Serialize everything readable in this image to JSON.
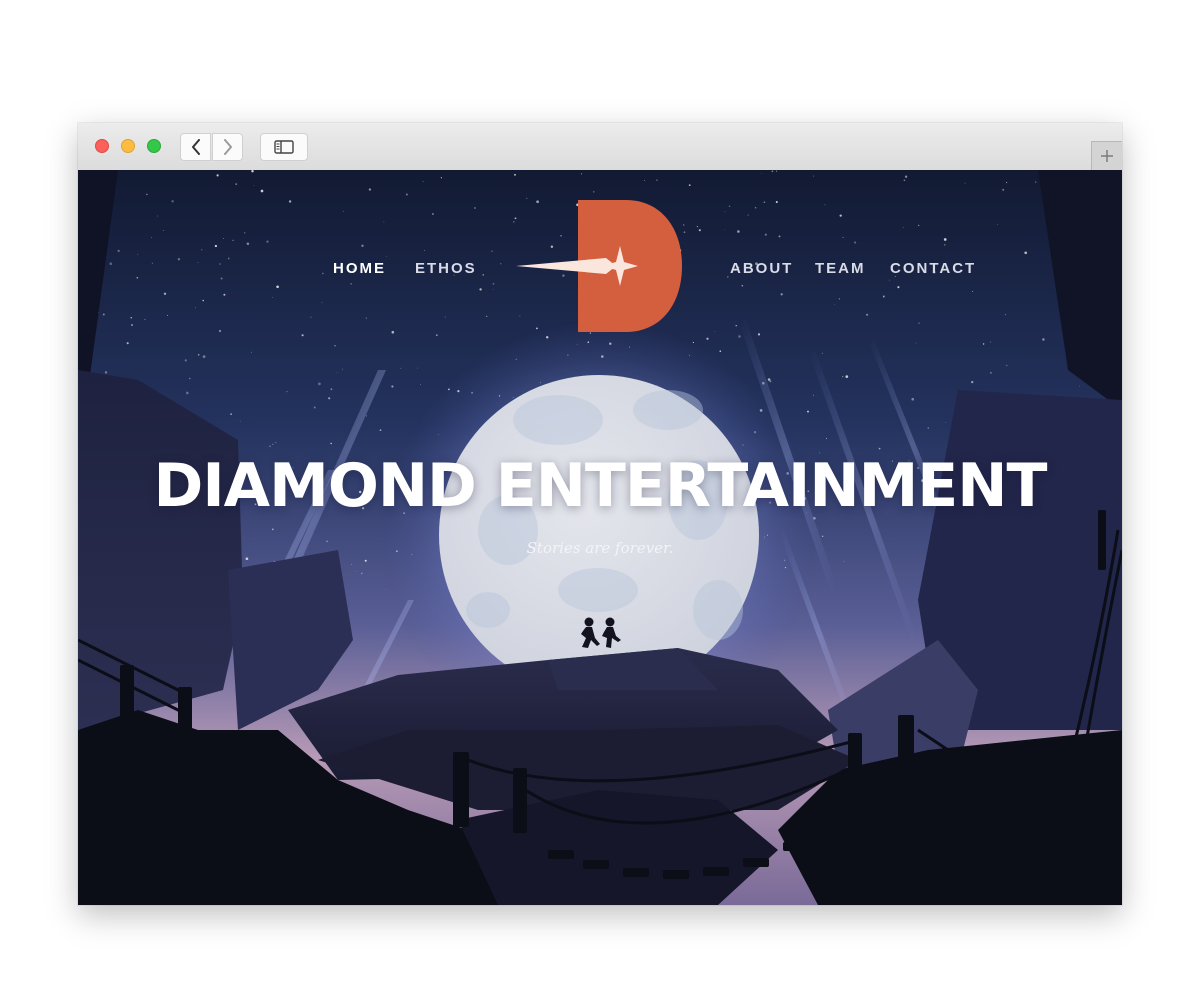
{
  "browser": {
    "buttons": {
      "close": "close-button",
      "minimize": "minimize-button",
      "maximize": "maximize-button"
    },
    "icons": [
      "back-icon",
      "forward-icon",
      "sidebar-icon",
      "plus-icon"
    ]
  },
  "site": {
    "nav": [
      {
        "label": "HOME",
        "active": true
      },
      {
        "label": "ETHOS",
        "active": false
      },
      {
        "label": "ABOUT",
        "active": false
      },
      {
        "label": "TEAM",
        "active": false
      },
      {
        "label": "CONTACT",
        "active": false
      }
    ],
    "logo_letter": "D",
    "title": "DIAMOND ENTERTAINMENT",
    "tagline": "Stories are forever."
  },
  "colors": {
    "brand": "#d35f3e",
    "sky_top": "#121a33",
    "moon": "#d9dbe3"
  }
}
